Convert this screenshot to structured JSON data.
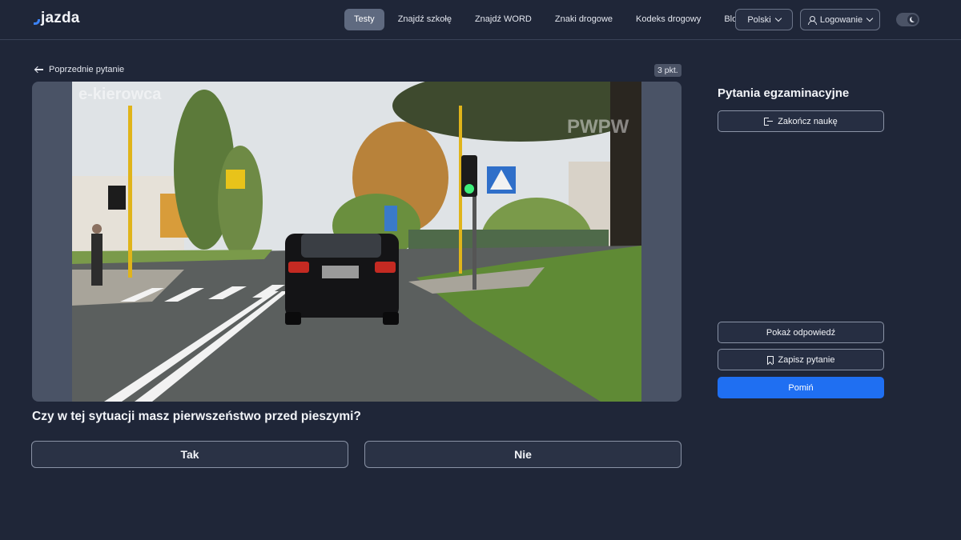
{
  "header": {
    "logo": "jazda",
    "nav": [
      {
        "label": "Testy",
        "active": true
      },
      {
        "label": "Znajdź szkołę",
        "active": false
      },
      {
        "label": "Znajdź WORD",
        "active": false
      },
      {
        "label": "Znaki drogowe",
        "active": false
      },
      {
        "label": "Kodeks drogowy",
        "active": false
      },
      {
        "label": "Blog",
        "active": false
      }
    ],
    "language": "Polski",
    "login": "Logowanie",
    "theme_icon": "moon-icon"
  },
  "question": {
    "back_label": "Poprzednie pytanie",
    "points": "3 pkt.",
    "watermark_left": "e-kierowca",
    "watermark_right": "PWPW",
    "text": "Czy w tej sytuacji masz pierwszeństwo przed pieszymi?",
    "answers": [
      "Tak",
      "Nie"
    ]
  },
  "sidebar": {
    "title": "Pytania egzaminacyjne",
    "end_label": "Zakończ naukę",
    "show_answer_label": "Pokaż odpowiedź",
    "save_label": "Zapisz pytanie",
    "skip_label": "Pomiń"
  },
  "colors": {
    "background": "#1f2638",
    "accent": "#1f6ff2",
    "active_nav": "#5f6a80"
  }
}
